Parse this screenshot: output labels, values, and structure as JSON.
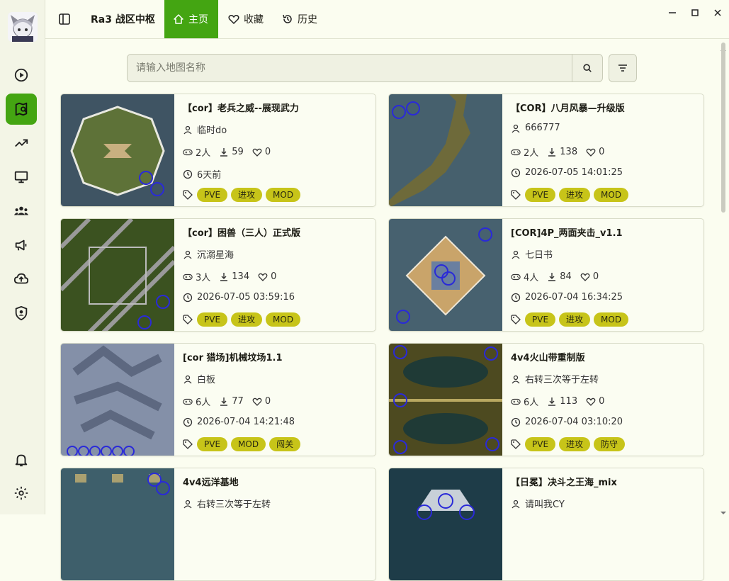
{
  "app": {
    "title": "Ra3 战区中枢"
  },
  "tabs": [
    {
      "label": "主页",
      "icon": "home-icon"
    },
    {
      "label": "收藏",
      "icon": "heart-icon"
    },
    {
      "label": "历史",
      "icon": "history-icon"
    }
  ],
  "sidebar": {
    "items": [
      {
        "name": "play-circle-icon"
      },
      {
        "name": "map-icon",
        "active": true
      },
      {
        "name": "trending-icon"
      },
      {
        "name": "monitor-icon"
      },
      {
        "name": "group-icon"
      },
      {
        "name": "megaphone-icon"
      },
      {
        "name": "cloud-upload-icon"
      },
      {
        "name": "shield-user-icon"
      }
    ],
    "bottom": [
      {
        "name": "bell-icon"
      },
      {
        "name": "settings-icon"
      }
    ]
  },
  "search": {
    "placeholder": "请输入地图名称",
    "value": ""
  },
  "colors": {
    "accent": "#44a512",
    "tag": "#c7c419",
    "background": "#fbfdf0"
  },
  "maps": [
    {
      "title": "【cor】老兵之威--展现武力",
      "author": "临时do",
      "players": "2人",
      "downloads": "59",
      "likes": "0",
      "time": "6天前",
      "tags": [
        "PVE",
        "进攻",
        "MOD"
      ]
    },
    {
      "title": "【COR】八月风暴—升级版",
      "author": "666777",
      "players": "2人",
      "downloads": "138",
      "likes": "0",
      "time": "2026-07-05 14:01:25",
      "tags": [
        "PVE",
        "进攻",
        "MOD"
      ]
    },
    {
      "title": "【cor】困兽（三人）正式版",
      "author": "沉溺星海",
      "players": "3人",
      "downloads": "134",
      "likes": "0",
      "time": "2026-07-05 03:59:16",
      "tags": [
        "PVE",
        "进攻",
        "MOD"
      ]
    },
    {
      "title": "[COR]4P_两面夹击_v1.1",
      "author": "七日书",
      "players": "4人",
      "downloads": "84",
      "likes": "0",
      "time": "2026-07-04 16:34:25",
      "tags": [
        "PVE",
        "进攻",
        "MOD"
      ]
    },
    {
      "title": "[cor 猎场]机械坟场1.1",
      "author": "白板",
      "players": "6人",
      "downloads": "77",
      "likes": "0",
      "time": "2026-07-04 14:21:48",
      "tags": [
        "PVE",
        "MOD",
        "闯关"
      ]
    },
    {
      "title": "4v4火山带重制版",
      "author": "右转三次等于左转",
      "players": "6人",
      "downloads": "113",
      "likes": "0",
      "time": "2026-07-04 03:10:20",
      "tags": [
        "PVE",
        "进攻",
        "防守"
      ]
    },
    {
      "title": "4v4远洋基地",
      "author": "右转三次等于左转",
      "players": "",
      "downloads": "",
      "likes": "",
      "time": "",
      "tags": []
    },
    {
      "title": "【日冕】决斗之王海_mix",
      "author": "请叫我CY",
      "players": "",
      "downloads": "",
      "likes": "",
      "time": "",
      "tags": []
    }
  ]
}
